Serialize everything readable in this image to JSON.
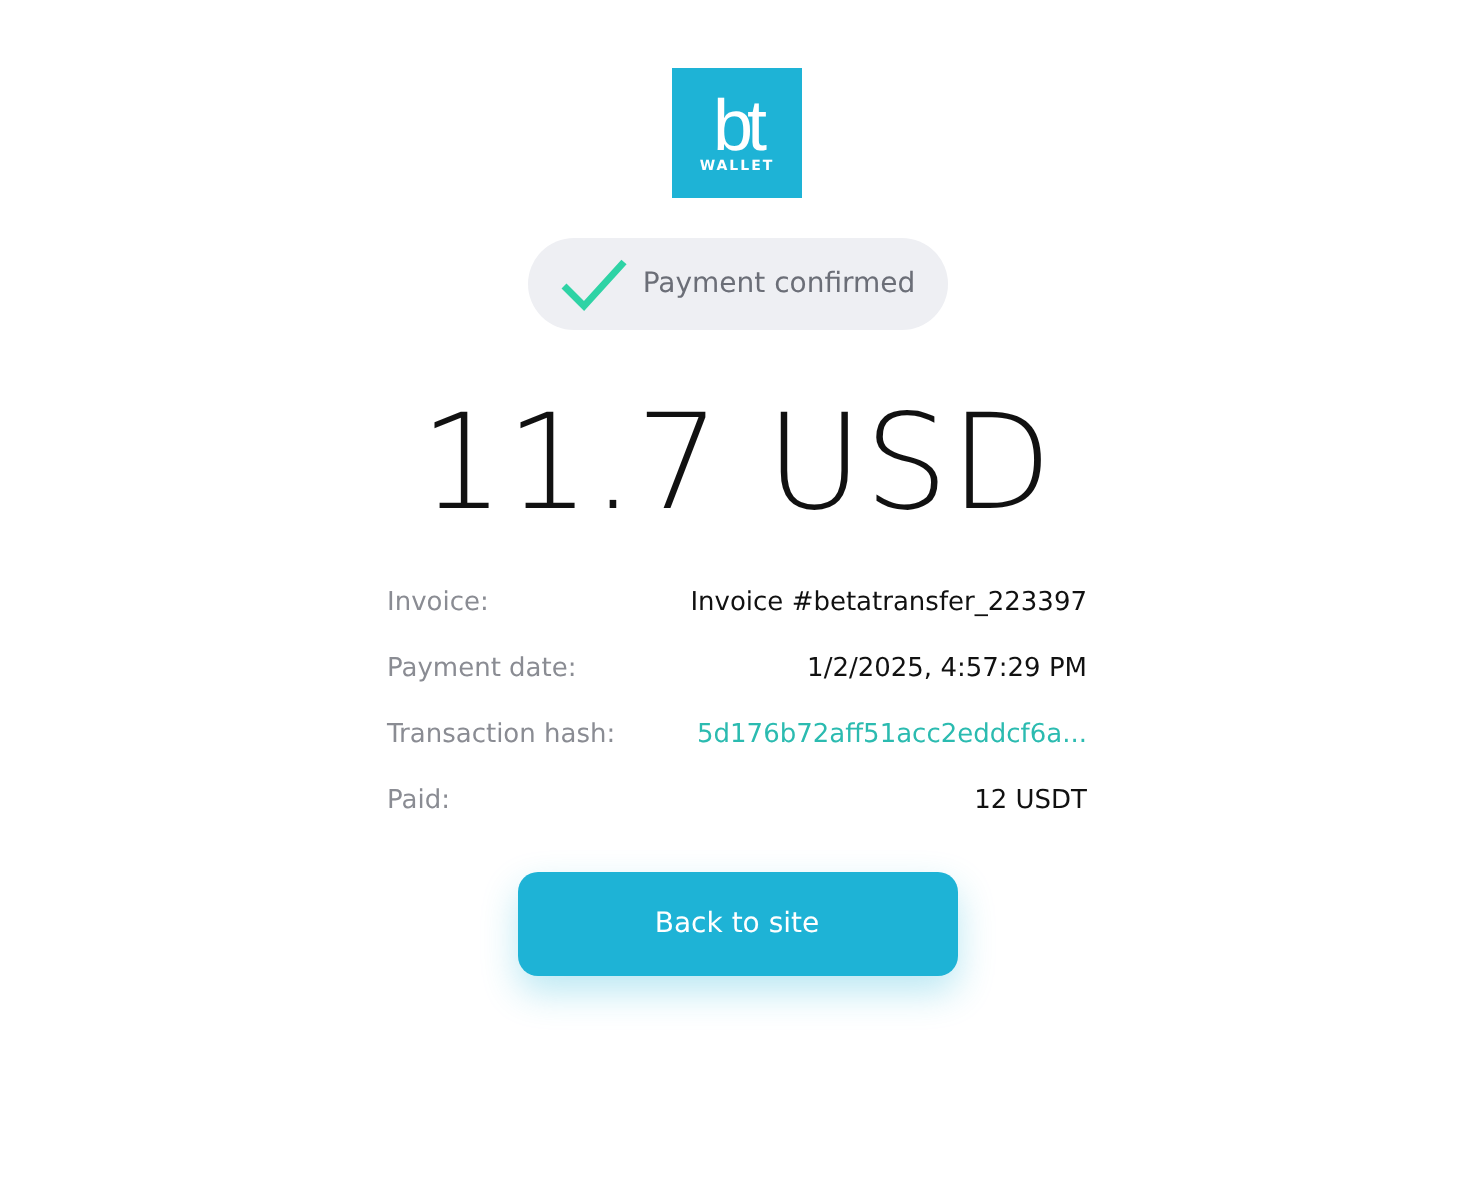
{
  "logo": {
    "mark": "bt",
    "caption": "WALLET"
  },
  "status": {
    "label": "Payment confirmed",
    "confirmed": true
  },
  "amount": "11.7 USD",
  "details": [
    {
      "label": "Invoice:",
      "value": "Invoice #betatransfer_223397",
      "kind": "text"
    },
    {
      "label": "Payment date:",
      "value": "1/2/2025, 4:57:29 PM",
      "kind": "text"
    },
    {
      "label": "Transaction hash:",
      "value": "5d176b72aff51acc2eddcf6a...",
      "kind": "link"
    },
    {
      "label": "Paid:",
      "value": "12 USDT",
      "kind": "text"
    }
  ],
  "button": "Back to site"
}
